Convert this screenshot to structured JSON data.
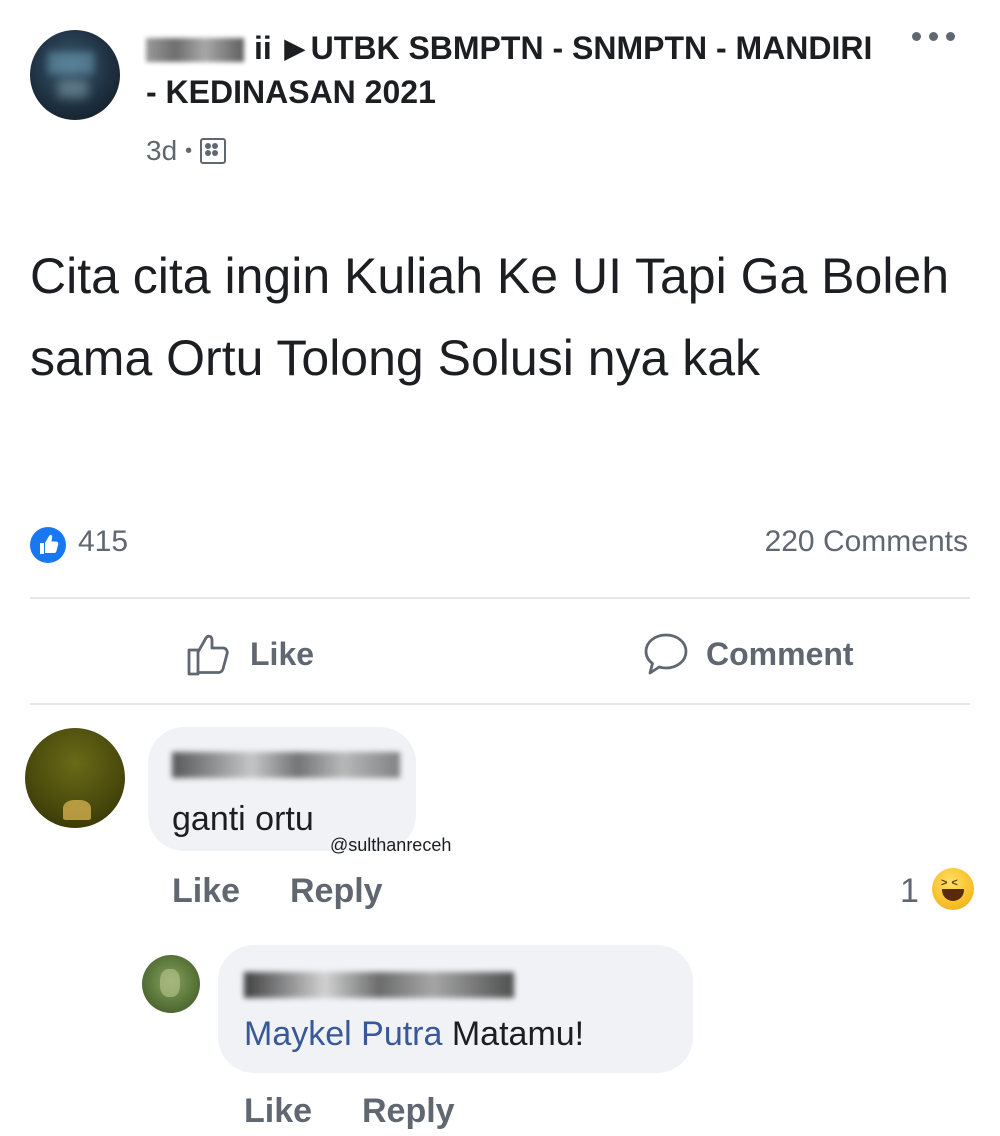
{
  "post": {
    "group_name": "UTBK SBMPTN - SNMPTN - MANDIRI - KEDINASAN 2021",
    "author_suffix": "ii",
    "time": "3d",
    "meta_separator": "•",
    "text": "Cita cita ingin Kuliah Ke UI Tapi Ga Boleh sama Ortu Tolong Solusi nya kak",
    "like_count": "415",
    "comments_count": "220 Comments"
  },
  "actions": {
    "like_label": "Like",
    "comment_label": "Comment"
  },
  "comments": [
    {
      "text": "ganti ortu",
      "like_label": "Like",
      "reply_label": "Reply",
      "reaction_count": "1"
    }
  ],
  "reply": {
    "mention": "Maykel Putra",
    "text": " Matamu!",
    "like_label": "Like",
    "reply_label": "Reply"
  },
  "watermark": "@sulthanreceh",
  "icons": {
    "more": "more-dots-icon",
    "group": "group-icon",
    "like_badge": "like-reaction-icon",
    "like_action": "thumbs-up-icon",
    "comment_action": "speech-bubble-icon",
    "haha": "haha-reaction-icon"
  },
  "colors": {
    "accent": "#1877f2",
    "mention": "#385898",
    "secondary_text": "#606770",
    "bubble": "#f0f2f5"
  }
}
